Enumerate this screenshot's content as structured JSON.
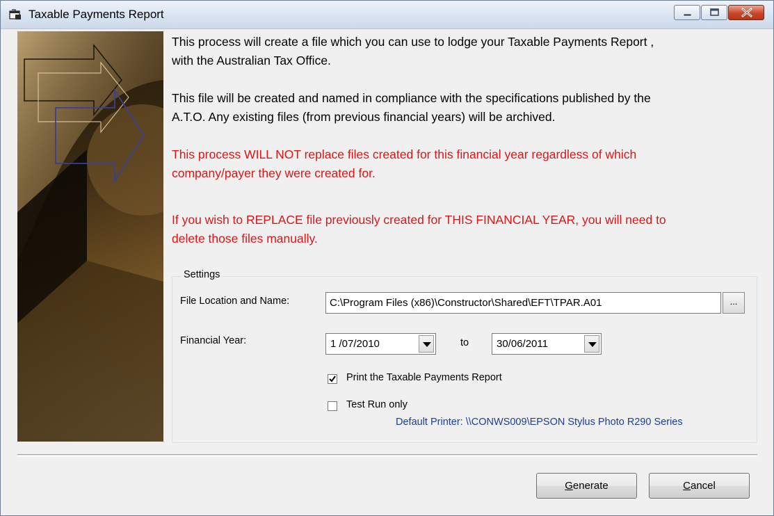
{
  "window": {
    "title": "Taxable Payments Report",
    "controls": {
      "minimize": "minimize-icon",
      "maximize": "maximize-icon",
      "close": "close-icon"
    }
  },
  "messages": [
    {
      "text": "This process will create a file which you can use to lodge your Taxable Payments Report ,",
      "color": "#000000"
    },
    {
      "text": "with the Australian Tax Office.",
      "color": "#000000"
    },
    {
      "text": "This file will be created and named in compliance with the specifications published by the",
      "color": "#000000"
    },
    {
      "text": "A.T.O. Any existing files (from previous financial years) will be archived.",
      "color": "#000000"
    },
    {
      "text": "This process WILL NOT replace files created for this financial year regardless of which",
      "color": "#e01414"
    },
    {
      "text": "company/payer they were created for.",
      "color": "#e01414"
    },
    {
      "text": "If you wish to REPLACE file previously created for THIS FINANCIAL YEAR, you will need to",
      "color": "#e01414"
    },
    {
      "text": "delete those files manually.",
      "color": "#e01414"
    }
  ],
  "settings": {
    "legend": "Settings",
    "file_label": "File Location and Name:",
    "file_value": "C:\\Program Files (x86)\\Constructor\\Shared\\EFT\\TPAR.A01",
    "browse_label": "...",
    "year_label": "Financial Year:",
    "from_date": "1 /07/2010",
    "to_label": "to",
    "to_date": "30/06/2011",
    "print_report": {
      "label": "Print the Taxable Payments Report",
      "checked": true
    },
    "test_run": {
      "label": "Test Run only",
      "checked": false
    },
    "default_printer": "Default Printer: \\\\CONWS009\\EPSON Stylus Photo R290 Series"
  },
  "buttons": {
    "generate": {
      "mnemonic": "G",
      "rest": "enerate"
    },
    "cancel": {
      "mnemonic": "C",
      "rest": "ancel"
    }
  },
  "colors": {
    "warning_text": "#e01414",
    "printer_text": "#1a3e9a"
  }
}
